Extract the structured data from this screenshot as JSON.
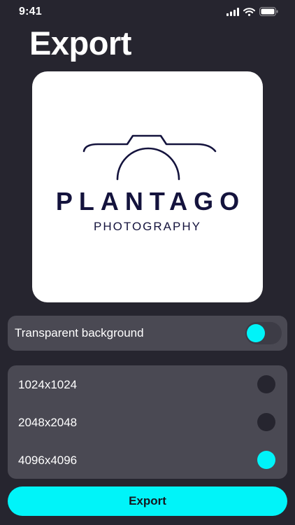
{
  "status_bar": {
    "time": "9:41",
    "icons": [
      "cellular-signal-icon",
      "wifi-icon",
      "battery-icon"
    ]
  },
  "page": {
    "title": "Export"
  },
  "preview": {
    "logo_name": "PLANTAGO",
    "logo_subtitle": "PHOTOGRAPHY",
    "logo_icon": "camera-outline-icon",
    "logo_color": "#14133d"
  },
  "options": {
    "transparent_label": "Transparent background",
    "transparent_enabled": true
  },
  "sizes": {
    "items": [
      {
        "label": "1024x1024",
        "selected": false
      },
      {
        "label": "2048x2048",
        "selected": false
      },
      {
        "label": "4096x4096",
        "selected": true
      }
    ]
  },
  "actions": {
    "export_label": "Export"
  },
  "colors": {
    "background": "#26252f",
    "panel": "#4a4953",
    "accent": "#00f4f9",
    "card": "#ffffff"
  }
}
